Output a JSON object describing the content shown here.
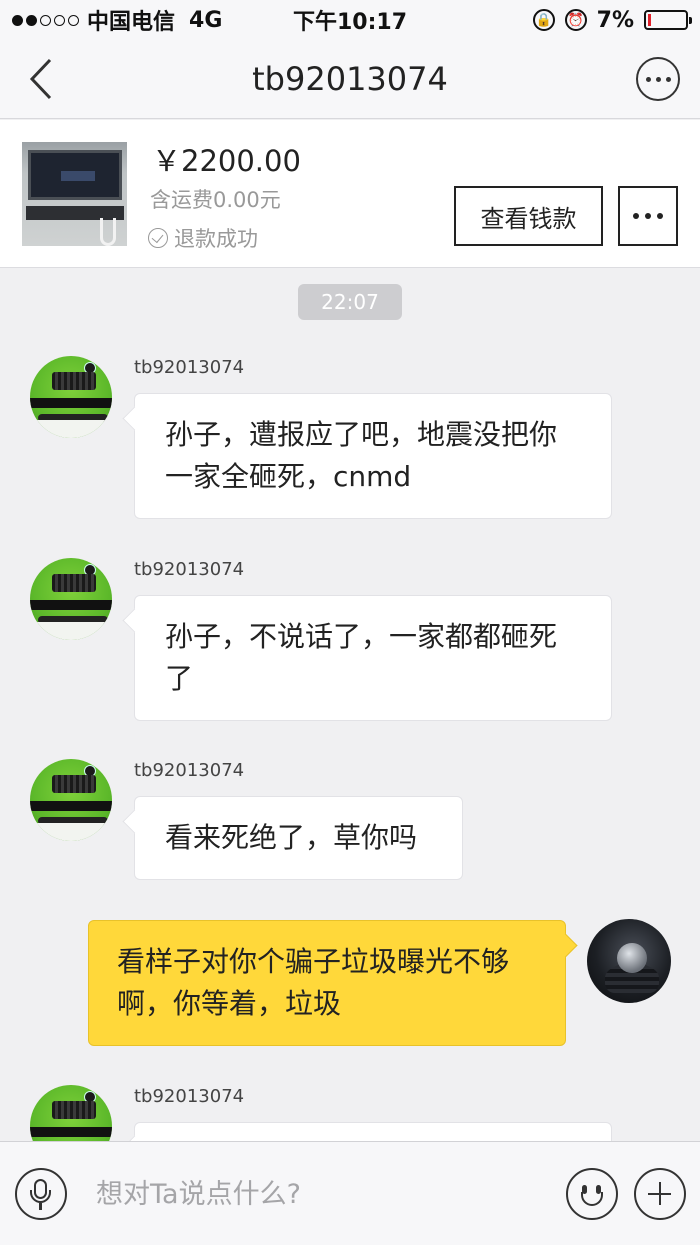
{
  "status_bar": {
    "carrier": "中国电信",
    "network": "4G",
    "time": "下午10:17",
    "battery_percent": "7%",
    "battery_level": 0.07,
    "signal_bars_filled": 2,
    "signal_bars_total": 5
  },
  "nav": {
    "title": "tb92013074",
    "back_icon": "chevron-left-icon",
    "more_icon": "ellipsis-circle-icon"
  },
  "product": {
    "price": "￥2200.00",
    "shipping": "含运费0.00元",
    "refund_status": "退款成功",
    "view_payment_label": "查看钱款"
  },
  "chat": {
    "timestamp": "22:07",
    "messages": [
      {
        "sender": "tb92013074",
        "text": "孙子，遭报应了吧，地震没把你一家全砸死，cnmd"
      },
      {
        "sender": "tb92013074",
        "text": "孙子，不说话了，一家都都砸死了"
      },
      {
        "sender": "tb92013074",
        "text": "看来死绝了，草你吗"
      },
      {
        "sender": "self",
        "text": "看样子对你个骗子垃圾曝光不够啊，你等着，垃圾"
      },
      {
        "sender": "tb92013074",
        "text": ""
      }
    ]
  },
  "input": {
    "placeholder": "想对Ta说点什么?",
    "value": ""
  },
  "colors": {
    "self_bubble": "#ffd83a",
    "other_bubble": "#ffffff",
    "background": "#f0f0f2",
    "battery_low": "#e0202a"
  }
}
